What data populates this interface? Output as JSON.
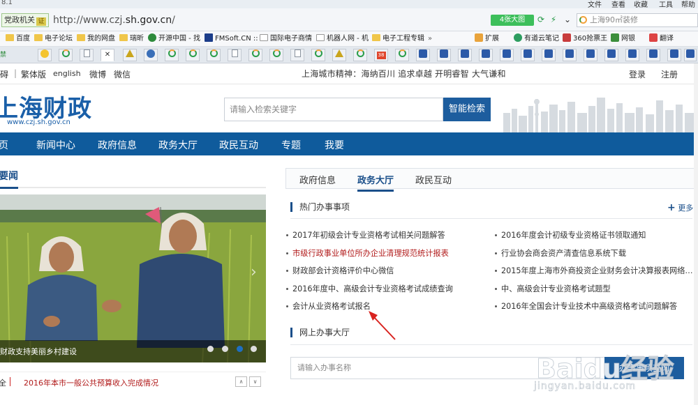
{
  "browser": {
    "title_version": "8.1",
    "menus": [
      "文件",
      "查看",
      "收藏",
      "工具",
      "帮助"
    ],
    "site_chip": "党政机关",
    "cert_badge": "证",
    "url_prefix": "http://www.czj.",
    "url_domain": "sh.gov.cn",
    "url_suffix": "/",
    "badge_4k": "4张大图",
    "search_text": "上海90㎡装修",
    "bookmarks": [
      "百度",
      "电子论坛",
      "我的网盘",
      "瑞昕",
      "开源中国 - 找",
      "FMSoft.CN ::",
      "国际电子商情",
      "机器人网 - 机",
      "电子工程专辑",
      "扩展",
      "有道云笔记",
      "360抢票王",
      "网银",
      "翻译"
    ],
    "tab_count_label": "38",
    "first_tab_label": "禁"
  },
  "site": {
    "toplinks": [
      "碍",
      "繁体版",
      "english",
      "微博",
      "微信"
    ],
    "slogan": "上海城市精神：海纳百川 追求卓越 开明睿智 大气谦和",
    "login": "登录",
    "register": "注册",
    "logo": "上海财政",
    "logo_url": "www.czj.sh.gov.cn",
    "search_placeholder": "请输入检索关键字",
    "search_button": "智能检索",
    "nav": [
      "页",
      "新闻中心",
      "政府信息",
      "政务大厅",
      "政民互动",
      "专题",
      "我要"
    ]
  },
  "news": {
    "heading": "要闻",
    "photo_caption": "财政支持美丽乡村建设",
    "ticker_lead": "全",
    "ticker_text": "2016年本市一般公共预算收入完成情况",
    "carousel_dots": 4,
    "carousel_active": 3
  },
  "service": {
    "tabs": [
      "政府信息",
      "政务大厅",
      "政民互动"
    ],
    "active_tab": "政务大厅",
    "hot_title": "热门办事事项",
    "more": "更多",
    "left_items": [
      {
        "text": "2017年初级会计专业资格考试相关问题解答",
        "red": false
      },
      {
        "text": "市级行政事业单位所办企业清理规范统计报表",
        "red": true
      },
      {
        "text": "财政部会计资格评价中心微信",
        "red": false
      },
      {
        "text": "2016年度中、高级会计专业资格考试成绩查询",
        "red": false
      },
      {
        "text": "会计从业资格考试报名",
        "red": false
      }
    ],
    "right_items": [
      {
        "text": "2016年度会计初级专业资格证书领取通知",
        "red": false
      },
      {
        "text": "行业协会商会资产清查信息系统下载",
        "red": false
      },
      {
        "text": "2015年度上海市外商投资企业财务会计决算报表网络…",
        "red": false
      },
      {
        "text": "中、高级会计专业资格考试题型",
        "red": false
      },
      {
        "text": "2016年全国会计专业技术中高级资格考试问题解答",
        "red": false
      }
    ],
    "online_title": "网上办事大厅",
    "online_placeholder": "请输入办事名称",
    "online_button": "办事事项查询"
  },
  "watermark": {
    "brand": "Baidu经验",
    "url": "jingyan.baidu.com"
  },
  "colors": {
    "brand": "#0f5b9c",
    "accent_red": "#b11a1a",
    "link": "#1a4f8a"
  }
}
